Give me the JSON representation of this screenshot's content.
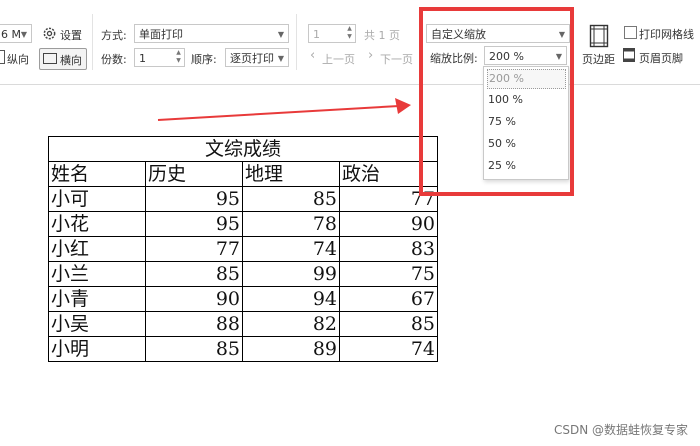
{
  "toolbar": {
    "paper_size": "6 M",
    "settings_label": "设置",
    "portrait_label": "纵向",
    "landscape_label": "横向",
    "mode_label": "方式:",
    "mode_value": "单面打印",
    "copies_label": "份数:",
    "copies_value": "1",
    "order_label": "顺序:",
    "order_value": "逐页打印",
    "page_current": "1",
    "page_total": "共 1 页",
    "prev_page": "上一页",
    "next_page": "下一页",
    "zoom_mode": "自定义缩放",
    "zoom_label": "缩放比例:",
    "zoom_value": "200 %",
    "margin_label": "页边距",
    "print_gridlines_label": "打印网格线",
    "header_footer_label": "页眉页脚"
  },
  "zoom_options": [
    "200 %",
    "100 %",
    "75 %",
    "50 %",
    "25 %"
  ],
  "sheet": {
    "title": "文综成绩",
    "headers": [
      "姓名",
      "历史",
      "地理",
      "政治"
    ],
    "rows": [
      [
        "小可",
        "95",
        "85",
        "77"
      ],
      [
        "小花",
        "95",
        "78",
        "90"
      ],
      [
        "小红",
        "77",
        "74",
        "83"
      ],
      [
        "小兰",
        "85",
        "99",
        "75"
      ],
      [
        "小青",
        "90",
        "94",
        "67"
      ],
      [
        "小吴",
        "88",
        "82",
        "85"
      ],
      [
        "小明",
        "85",
        "89",
        "74"
      ]
    ]
  },
  "watermark": "CSDN @数据蛙恢复专家",
  "colors": {
    "highlight": "#e83a3a",
    "arrow": "#e83a3a"
  }
}
